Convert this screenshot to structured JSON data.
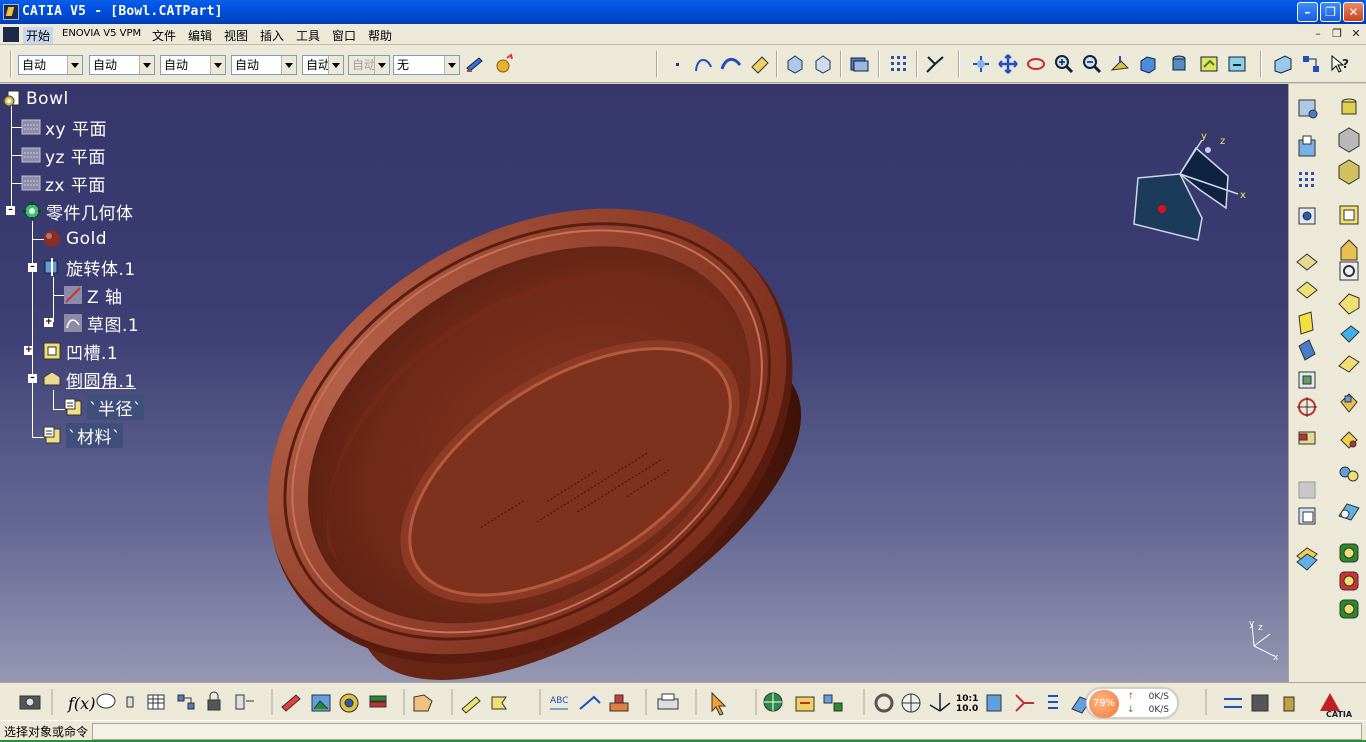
{
  "window": {
    "title": "CATIA V5 - [Bowl.CATPart]"
  },
  "menu": {
    "items": [
      "开始",
      "ENOVIA V5 VPM",
      "文件",
      "编辑",
      "视图",
      "插入",
      "工具",
      "窗口",
      "帮助"
    ]
  },
  "combos": [
    {
      "value": "自动",
      "disabled": false
    },
    {
      "value": "自动",
      "disabled": false
    },
    {
      "value": "自动",
      "disabled": false
    },
    {
      "value": "自动",
      "disabled": false
    },
    {
      "value": "自动",
      "disabled": false
    },
    {
      "value": "自动",
      "disabled": true
    },
    {
      "value": "无",
      "disabled": false
    }
  ],
  "tree": {
    "root": "Bowl",
    "planes": [
      "xy 平面",
      "yz 平面",
      "zx 平面"
    ],
    "body": "零件几何体",
    "material_applied": "Gold",
    "revolve": "旋转体.1",
    "axis": "Z 轴",
    "sketch": "草图.1",
    "groove": "凹槽.1",
    "fillet": "倒圆角.1",
    "radius_param": "`半径`",
    "material_param": "`材料`"
  },
  "compass": {
    "x": "x",
    "y": "y",
    "z": "z"
  },
  "mini_axis": {
    "y": "y",
    "z": "z",
    "x": "x"
  },
  "netmeter": {
    "percent": "79%",
    "up": "0K/S",
    "down": "0K/S"
  },
  "status": {
    "message": "选择对象或命令"
  },
  "colors": {
    "title_bar": "#0055e5",
    "viewport_top": "#35366a",
    "viewport_bottom": "#9697b2",
    "bowl": "#7a2e1c",
    "chrome": "#ece9d8"
  }
}
